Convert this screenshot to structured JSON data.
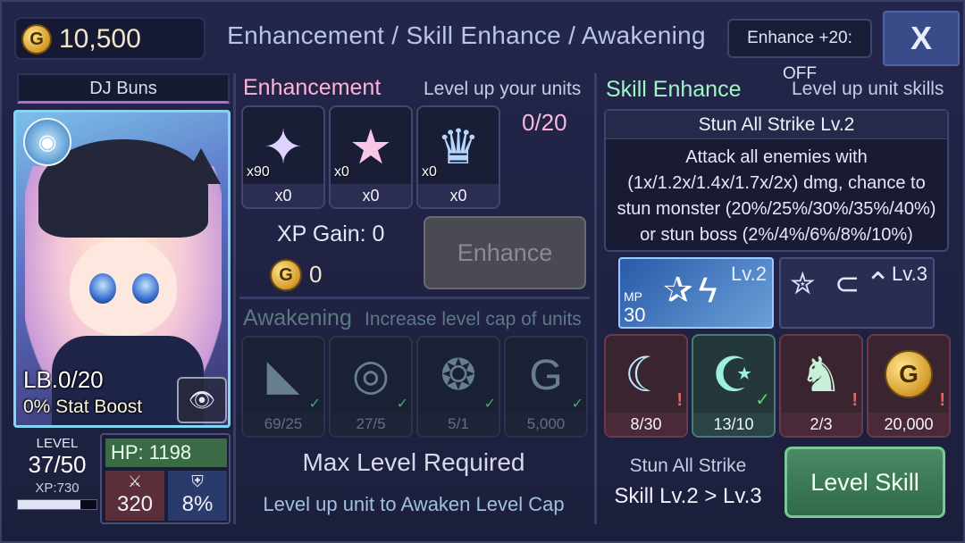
{
  "header": {
    "gold_icon": "G",
    "gold": "10,500",
    "title": "Enhancement / Skill Enhance / Awakening",
    "enhance20": "Enhance +20: OFF",
    "close": "X"
  },
  "unit": {
    "name": "DJ Buns",
    "limit_break": "LB.0/20",
    "stat_boost": "0% Stat Boost",
    "level_label": "LEVEL",
    "level": "37/50",
    "xp_label": "XP:730",
    "xp_fill_fraction": 0.8,
    "hp": "HP: 1198",
    "atk": "320",
    "def": "8%",
    "element_icon": "ripple-icon"
  },
  "enhancement": {
    "title": "Enhancement",
    "subtitle": "Level up your units",
    "count": "0/20",
    "materials": [
      {
        "icon": "sparkle-icon",
        "glyph": "✦",
        "owned": "x90",
        "selected": "x0"
      },
      {
        "icon": "star-icon",
        "glyph": "★",
        "owned": "x0",
        "selected": "x0"
      },
      {
        "icon": "fairy-icon",
        "glyph": "♛",
        "owned": "x0",
        "selected": "x0"
      }
    ],
    "xp_gain": "XP Gain: 0",
    "gold_cost": "0",
    "button": "Enhance"
  },
  "awakening": {
    "title": "Awakening",
    "subtitle": "Increase level cap of units",
    "materials": [
      {
        "icon": "feather-icon",
        "glyph": "◣",
        "req": "69/25"
      },
      {
        "icon": "disc-icon",
        "glyph": "◎",
        "req": "27/5"
      },
      {
        "icon": "winged-disc-icon",
        "glyph": "❂",
        "req": "5/1"
      },
      {
        "icon": "gold-coin-icon",
        "glyph": "G",
        "req": "5,000"
      }
    ],
    "message": "Max Level Required",
    "submessage": "Level up unit to Awaken Level Cap"
  },
  "skill": {
    "title": "Skill Enhance",
    "subtitle": "Level up unit skills",
    "name_lv": "Stun All Strike Lv.2",
    "description": "Attack all enemies with (1x/1.2x/1.4x/1.7x/2x) dmg, chance to stun monster (20%/25%/30%/35%/40%) or stun boss (2%/4%/6%/8%/10%)",
    "card1": {
      "lv": "Lv.2",
      "mp_label": "MP",
      "mp": "30",
      "glyph": "✰ϟ"
    },
    "card2": {
      "lv": "Lv.3",
      "glyph": "✮ ⊂⌃"
    },
    "materials": [
      {
        "icon": "moon-icon",
        "glyph": "☾",
        "req": "8/30",
        "flag": "!",
        "style": "red"
      },
      {
        "icon": "crescent-orb-icon",
        "glyph": "☪",
        "req": "13/10",
        "flag": "✓",
        "style": "green"
      },
      {
        "icon": "bunny-icon",
        "glyph": "♞",
        "req": "2/3",
        "flag": "!",
        "style": "red"
      },
      {
        "icon": "gold-coin-icon",
        "glyph": "G",
        "req": "20,000",
        "flag": "!",
        "style": "red"
      }
    ],
    "footer_name": "Stun All Strike",
    "footer_lvl": "Skill Lv.2 > Lv.3",
    "button": "Level Skill"
  },
  "colors": {
    "enhancement_title": "#ffb3d9",
    "skill_title": "#9ff5c4",
    "level_skill_button": "#3f7a58",
    "close_button": "#3a4b8a"
  }
}
